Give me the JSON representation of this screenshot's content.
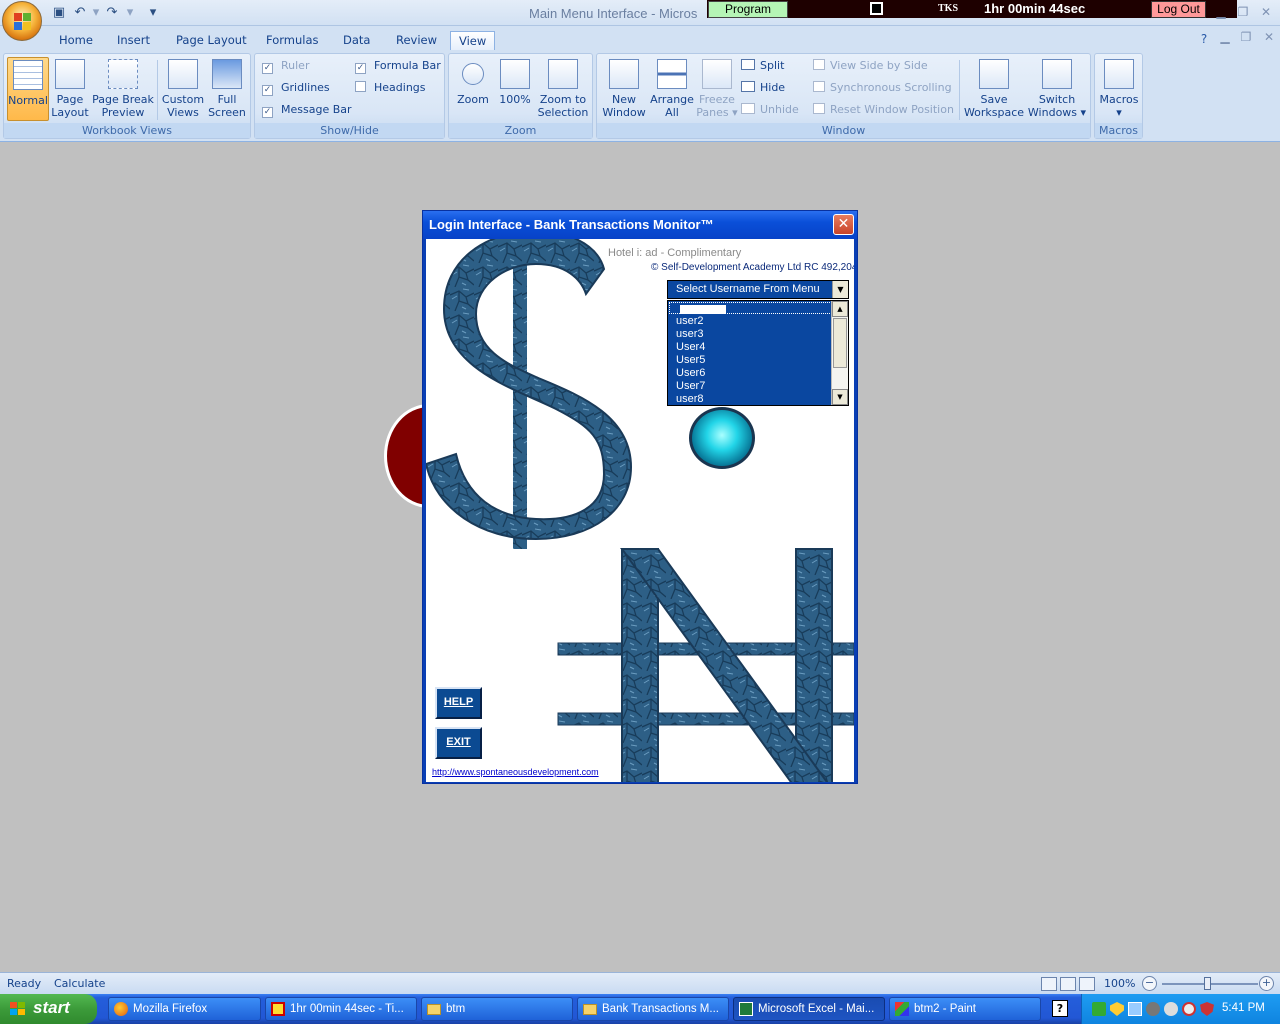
{
  "window": {
    "title": "Main Menu Interface  -  Micros",
    "controls": {
      "minimize": "▁",
      "restore": "❐",
      "close": "✕"
    }
  },
  "quick_access": {
    "save_icon": "save-icon",
    "undo_icon": "undo-icon",
    "redo_icon": "redo-icon",
    "customize_icon": "dropdown-icon"
  },
  "overlay": {
    "program_label": "Program",
    "tks_label": "TKS",
    "timer": "1hr 00min 44sec",
    "logout_label": "Log Out"
  },
  "ribbon": {
    "tabs": [
      "Home",
      "Insert",
      "Page Layout",
      "Formulas",
      "Data",
      "Review",
      "View"
    ],
    "active_tab": "View",
    "groups": {
      "workbook_views": {
        "label": "Workbook Views",
        "normal": "Normal",
        "page_layout_1": "Page",
        "page_layout_2": "Layout",
        "page_break_1": "Page Break",
        "page_break_2": "Preview",
        "custom_views_1": "Custom",
        "custom_views_2": "Views",
        "full_screen_1": "Full",
        "full_screen_2": "Screen"
      },
      "show_hide": {
        "label": "Show/Hide",
        "ruler": "Ruler",
        "gridlines": "Gridlines",
        "message_bar": "Message Bar",
        "formula_bar": "Formula Bar",
        "headings": "Headings"
      },
      "zoom": {
        "label": "Zoom",
        "zoom": "Zoom",
        "hundred": "100%",
        "zoom_sel_1": "Zoom to",
        "zoom_sel_2": "Selection"
      },
      "window": {
        "label": "Window",
        "new_1": "New",
        "new_2": "Window",
        "arrange_1": "Arrange",
        "arrange_2": "All",
        "freeze_1": "Freeze",
        "freeze_2": "Panes",
        "split": "Split",
        "hide": "Hide",
        "unhide": "Unhide",
        "side_by_side": "View Side by Side",
        "sync_scroll": "Synchronous Scrolling",
        "reset_pos": "Reset Window Position",
        "save_ws_1": "Save",
        "save_ws_2": "Workspace",
        "switch_1": "Switch",
        "switch_2": "Windows"
      },
      "macros": {
        "label": "Macros",
        "macros": "Macros"
      }
    }
  },
  "dialog": {
    "title": "Login Interface - Bank Transactions Monitor™",
    "hotel_line": "Hotel  i:                         ad - Complimentary",
    "copyright": "© Self-Development Academy Ltd RC 492,204",
    "combo_text": "Select Username From Menu",
    "users": [
      "user2",
      "user3",
      "User4",
      "User5",
      "User6",
      "User7",
      "user8"
    ],
    "help_label": "HELP",
    "exit_label": "EXIT",
    "link": "http://www.spontaneousdevelopment.com"
  },
  "statusbar": {
    "ready": "Ready",
    "calculate": "Calculate",
    "zoom": "100%",
    "zoom_level": 1.0,
    "minus": "−",
    "plus": "+"
  },
  "taskbar": {
    "start": "start",
    "tasks": [
      {
        "label": "Mozilla Firefox",
        "icon": "firefox-icon"
      },
      {
        "label": "1hr 00min 44sec - Ti...",
        "icon": "timer-icon"
      },
      {
        "label": "btm",
        "icon": "folder-icon"
      },
      {
        "label": "Bank Transactions M...",
        "icon": "folder-icon"
      },
      {
        "label": "Microsoft Excel - Mai...",
        "icon": "excel-icon"
      },
      {
        "label": "btm2 - Paint",
        "icon": "paint-icon"
      }
    ],
    "help": "?",
    "clock": "5:41 PM"
  },
  "colors": {
    "ribbon_bg": "#d2e1f3",
    "workspace_bg": "#c0c0c0",
    "dialog_accent": "#0a47a0",
    "taskbar": "#245edb",
    "start_green": "#3c9b3a"
  }
}
